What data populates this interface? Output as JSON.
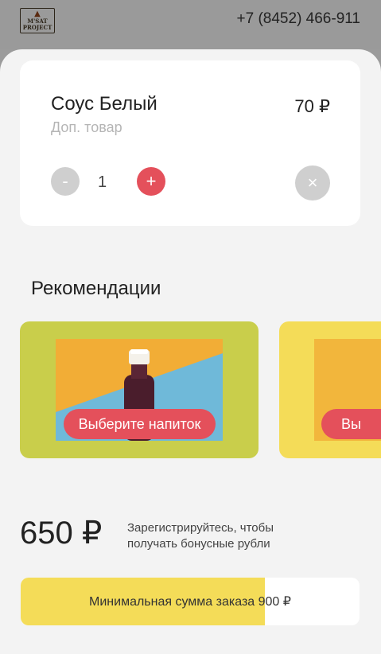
{
  "header": {
    "logo_line1": "M'SAT",
    "logo_line2": "PROJECT",
    "phone": "+7 (8452) 466-911"
  },
  "cart_item": {
    "title": "Соус Белый",
    "subtitle": "Доп. товар",
    "price": "70 ₽",
    "quantity": "1",
    "minus_label": "-",
    "plus_label": "+",
    "remove_label": "×"
  },
  "recommendations": {
    "title": "Рекомендации",
    "items": [
      {
        "button_label": "Выберите напиток"
      },
      {
        "button_label": "Вы"
      }
    ]
  },
  "summary": {
    "total": "650 ₽",
    "register_text": "Зарегистрируйтесь, чтобы получать бонусные рубли",
    "min_order_label": "Минимальная сумма заказа 900 ₽",
    "min_order_progress": 0.72
  },
  "colors": {
    "accent_red": "#e4505b",
    "card_green": "#c9ce4b",
    "card_yellow": "#f4dc58"
  }
}
